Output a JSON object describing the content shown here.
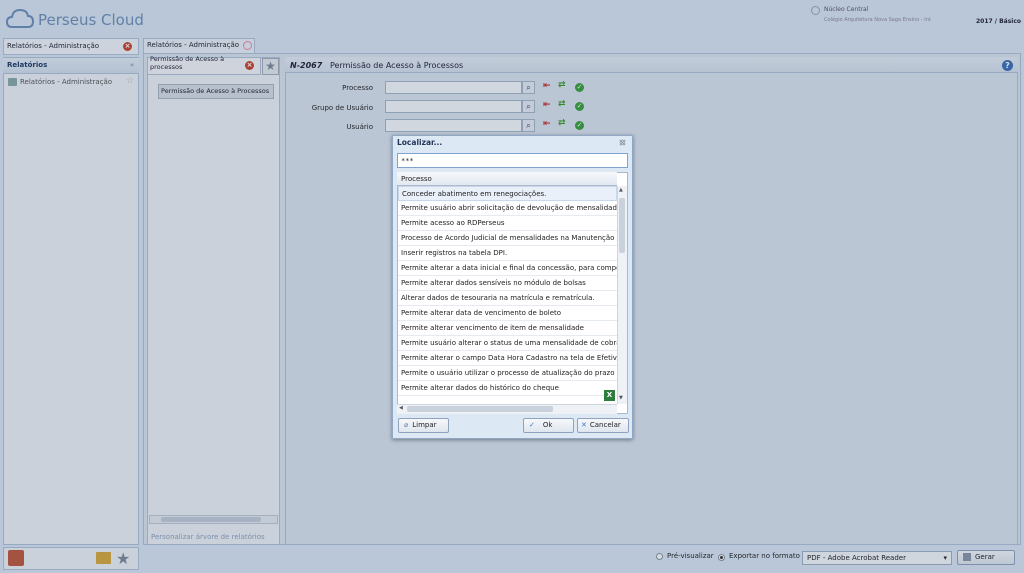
{
  "app": {
    "logo_text": "Perseus Cloud",
    "user_name": "Núcleo Central",
    "user_sub": "Colégio Arquitetura Nova Saga Ensino - Int",
    "year_label": "2017 / Básico"
  },
  "left_panel": {
    "tab_label": "Relatórios - Administração",
    "title": "Relatórios",
    "item_label": "Relatórios - Administração"
  },
  "center": {
    "tab_label": "Relatórios - Administração",
    "tree_head": "Permissão de Acesso à processos",
    "tree_item": "Permissão de Acesso à Processos",
    "footer_link": "Personalizar árvore de relatórios"
  },
  "form": {
    "code": "N-2067",
    "title": "Permissão de Acesso à Processos",
    "fields": [
      {
        "label": "Processo",
        "value": ""
      },
      {
        "label": "Grupo de Usuário",
        "value": ""
      },
      {
        "label": "Usuário",
        "value": ""
      }
    ]
  },
  "modal": {
    "title": "Localizar...",
    "search_value": "***",
    "column_header": "Processo",
    "rows": [
      "Conceder abatimento em renegociações.",
      "Permite usuário abrir solicitação de devolução de mensalidade",
      "Permite acesso ao RDPerseus",
      "Processo de Acordo Judicial de mensalidades na Manutenção de Mensalidades",
      "Inserir registros na tabela DPI.",
      "Permite alterar a data inicial e final da concessão, para competências anteriores",
      "Permite alterar dados sensíveis no módulo de bolsas",
      "Alterar dados de tesouraria na matrícula e rematrícula.",
      "Permite alterar data de vencimento de boleto",
      "Permite alterar vencimento de item de mensalidade",
      "Permite usuário alterar o status de uma mensalidade de cobrança",
      "Permite alterar o campo Data Hora Cadastro na tela de Efetividade",
      "Permite o usuário utilizar o processo de atualização do prazo de pagamento",
      "Permite alterar dados do histórico do cheque"
    ],
    "clear_label": "Limpar",
    "ok_label": "Ok",
    "cancel_label": "Cancelar"
  },
  "footer": {
    "preview_label": "Pré-visualizar",
    "export_label": "Exportar no formato",
    "format_value": "PDF - Adobe Acrobat Reader",
    "generate_label": "Gerar"
  },
  "icons": {
    "delete": "red-arrow-icon",
    "edit": "green-red-arrows-icon",
    "confirm": "green-check-icon",
    "search": "magnifier-icon"
  }
}
